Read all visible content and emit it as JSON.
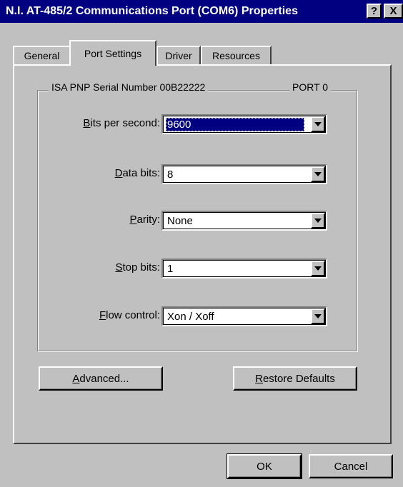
{
  "window": {
    "title": "N.I. AT-485/2 Communications Port (COM6) Properties",
    "help_button": "?",
    "close_button": "X"
  },
  "tabs": [
    {
      "label": "General",
      "active": false
    },
    {
      "label": "Port Settings",
      "active": true
    },
    {
      "label": "Driver",
      "active": false
    },
    {
      "label": "Resources",
      "active": false
    }
  ],
  "group": {
    "label_left": "ISA PNP Serial Number 00B22222",
    "label_right": "PORT 0"
  },
  "fields": {
    "bits_per_second": {
      "mnemonic": "B",
      "label_rest": "its per second:",
      "value": "9600"
    },
    "data_bits": {
      "mnemonic": "D",
      "label_rest": "ata bits:",
      "value": "8"
    },
    "parity": {
      "mnemonic": "P",
      "label_rest": "arity:",
      "value": "None"
    },
    "stop_bits": {
      "mnemonic": "S",
      "label_rest": "top bits:",
      "value": "1"
    },
    "flow_control": {
      "mnemonic": "F",
      "label_rest": "low control:",
      "value": "Xon / Xoff"
    }
  },
  "buttons": {
    "advanced": {
      "mnemonic": "A",
      "label_rest": "dvanced..."
    },
    "restore_defaults": {
      "mnemonic": "R",
      "label_rest": "estore Defaults"
    },
    "ok": "OK",
    "cancel": "Cancel"
  }
}
